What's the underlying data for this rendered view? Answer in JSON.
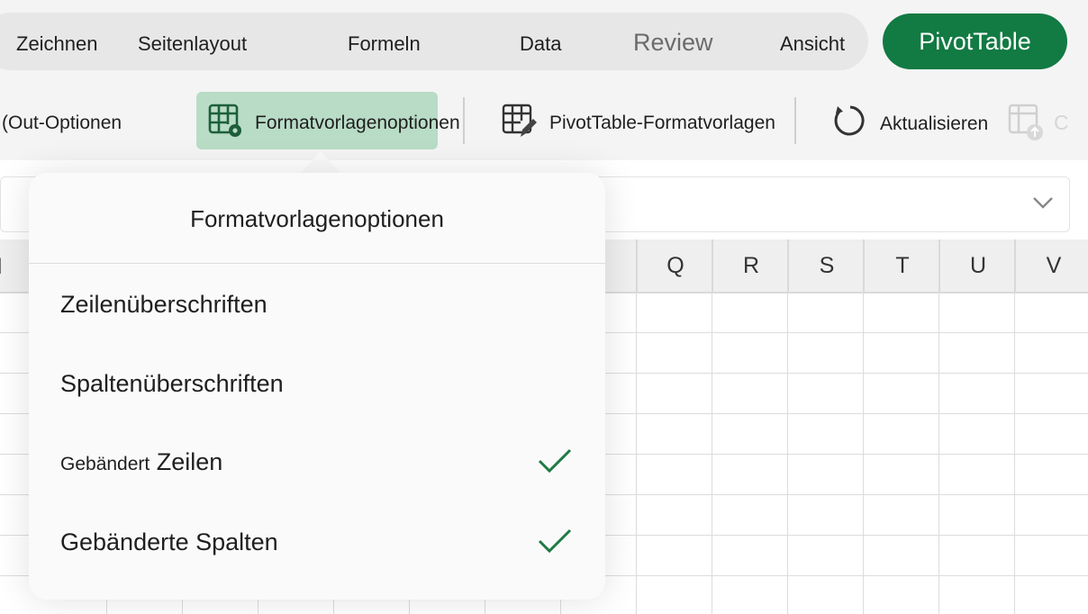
{
  "tabs": [
    "Zeichnen",
    "Seitenlayout",
    "Formeln",
    "Data",
    "Review",
    "Ansicht"
  ],
  "active_tab": "PivotTable",
  "ribbon": {
    "layout_options_label": "(Out-Optionen",
    "style_options_label": "Formatvorlagenoptionen",
    "pivot_styles_label": "PivotTable-Formatvorlagen",
    "refresh_label": "Aktualisieren",
    "faded_label": "C"
  },
  "columns": [
    "Q",
    "R",
    "S",
    "T",
    "U",
    "V"
  ],
  "left_column_partial": "I",
  "popover": {
    "title": "Formatvorlagenoptionen",
    "options": [
      {
        "label": "Zeilenüberschriften",
        "checked": false
      },
      {
        "label": "Spaltenüberschriften",
        "checked": false
      },
      {
        "label_small": "Gebändert",
        "label": "Zeilen",
        "checked": true
      },
      {
        "label": "Gebänderte Spalten",
        "checked": true
      }
    ]
  },
  "colors": {
    "accent": "#127a43",
    "selected_bg": "#b9dcc6"
  }
}
